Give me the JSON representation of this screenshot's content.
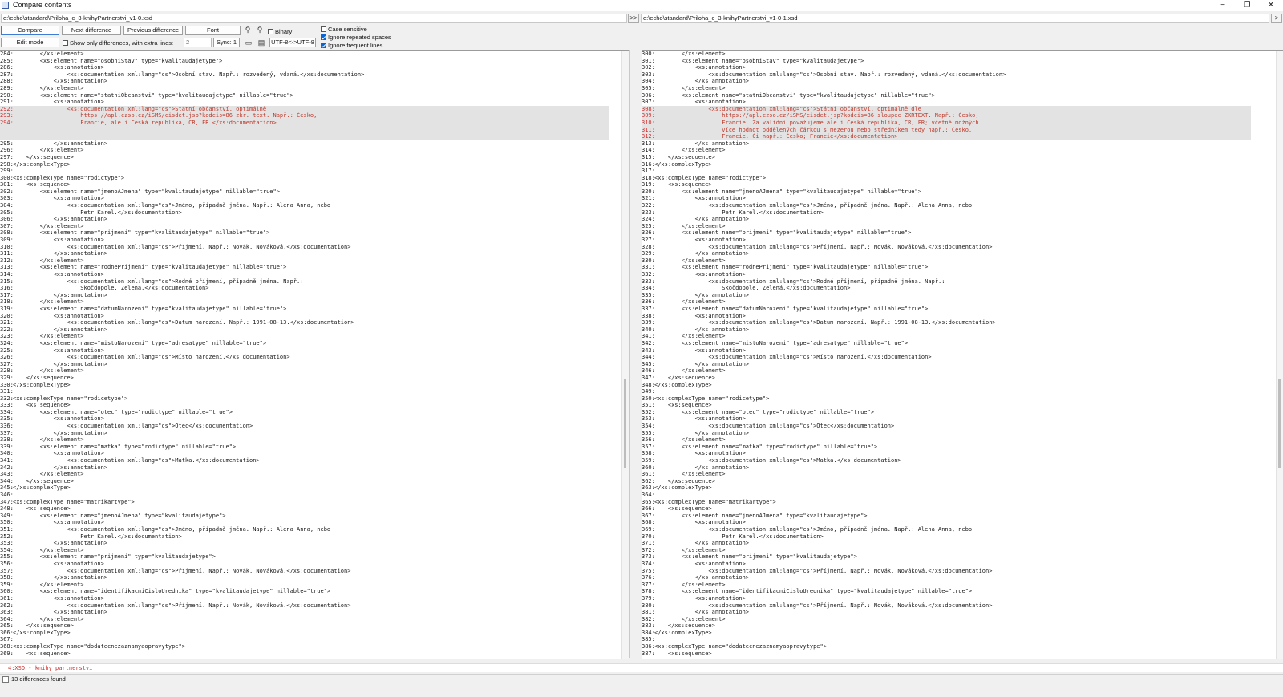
{
  "window": {
    "title": "Compare contents",
    "minimize": "−",
    "maximize": "❐",
    "close": "✕"
  },
  "paths": {
    "left": "e:\\echo\\standard\\Priloha_c_3-knihyPartnerstvi_v1-0.xsd",
    "right": "e:\\echo\\standard\\Priloha_c_3-knihyPartnerstvi_v1-0-1.xsd",
    "left_btn": ">>",
    "right_btn": ">"
  },
  "toolbar": {
    "compare": "Compare",
    "next": "Next difference",
    "prev": "Previous difference",
    "font": "Font",
    "binary": "Binary",
    "case_sensitive": "Case sensitive",
    "ignore_spaces": "Ignore repeated spaces",
    "ignore_frequent": "Ignore frequent lines",
    "edit_mode": "Edit mode",
    "show_only": "Show only differences, with extra lines:",
    "extra_lines": "2",
    "sync": "Sync: 1",
    "encoding": "UTF-8<->UTF-8"
  },
  "left": {
    "lines": [
      [
        "284:",
        "        </xs:element>"
      ],
      [
        "285:",
        "        <xs:element name=\"osobniStav\" type=\"kvalitaudajetype\">"
      ],
      [
        "286:",
        "            <xs:annotation>"
      ],
      [
        "287:",
        "                <xs:documentation xml:lang=\"cs\">Osobní stav. Např.: rozvedený, vdaná.</xs:documentation>"
      ],
      [
        "288:",
        "            </xs:annotation>"
      ],
      [
        "289:",
        "        </xs:element>"
      ],
      [
        "290:",
        "        <xs:element name=\"statniObcanstvi\" type=\"kvalitaudajetype\" nillable=\"true\">"
      ],
      [
        "291:",
        "            <xs:annotation>"
      ],
      [
        "292:",
        "                <xs:documentation xml:lang=\"cs\">Státní občanství, optimálně",
        "diff"
      ],
      [
        "293:",
        "                    https://apl.czso.cz/iSMS/cisdet.jsp?kodcis=86 zkr. text. Např.: Česko,",
        "diff"
      ],
      [
        "294:",
        "                    Francie, ale i Česká republika, ČR, FR.</xs:documentation>",
        "diff"
      ],
      [
        "",
        "",
        "pad"
      ],
      [
        "",
        "",
        "pad"
      ],
      [
        "295:",
        "            </xs:annotation>"
      ],
      [
        "296:",
        "        </xs:element>"
      ],
      [
        "297:",
        "    </xs:sequence>"
      ],
      [
        "298:",
        "</xs:complexType>"
      ],
      [
        "299:",
        ""
      ],
      [
        "300:",
        "<xs:complexType name=\"rodictype\">"
      ],
      [
        "301:",
        "    <xs:sequence>"
      ],
      [
        "302:",
        "        <xs:element name=\"jmenoAJmena\" type=\"kvalitaudajetype\" nillable=\"true\">"
      ],
      [
        "303:",
        "            <xs:annotation>"
      ],
      [
        "304:",
        "                <xs:documentation xml:lang=\"cs\">Jméno, případně jména. Např.: Alena Anna, nebo"
      ],
      [
        "305:",
        "                    Petr Karel.</xs:documentation>"
      ],
      [
        "306:",
        "            </xs:annotation>"
      ],
      [
        "307:",
        "        </xs:element>"
      ],
      [
        "308:",
        "        <xs:element name=\"prijmeni\" type=\"kvalitaudajetype\" nillable=\"true\">"
      ],
      [
        "309:",
        "            <xs:annotation>"
      ],
      [
        "310:",
        "                <xs:documentation xml:lang=\"cs\">Příjmení. Např.: Novák, Nováková.</xs:documentation>"
      ],
      [
        "311:",
        "            </xs:annotation>"
      ],
      [
        "312:",
        "        </xs:element>"
      ],
      [
        "313:",
        "        <xs:element name=\"rodnePrijmeni\" type=\"kvalitaudajetype\" nillable=\"true\">"
      ],
      [
        "314:",
        "            <xs:annotation>"
      ],
      [
        "315:",
        "                <xs:documentation xml:lang=\"cs\">Rodné příjmení, případně jména. Např.:"
      ],
      [
        "316:",
        "                    Skočdopole, Zelená.</xs:documentation>"
      ],
      [
        "317:",
        "            </xs:annotation>"
      ],
      [
        "318:",
        "        </xs:element>"
      ],
      [
        "319:",
        "        <xs:element name=\"datumNarozeni\" type=\"kvalitaudajetype\" nillable=\"true\">"
      ],
      [
        "320:",
        "            <xs:annotation>"
      ],
      [
        "321:",
        "                <xs:documentation xml:lang=\"cs\">Datum narození. Např.: 1991-08-13.</xs:documentation>"
      ],
      [
        "322:",
        "            </xs:annotation>"
      ],
      [
        "323:",
        "        </xs:element>"
      ],
      [
        "324:",
        "        <xs:element name=\"mistoNarozeni\" type=\"adresatype\" nillable=\"true\">"
      ],
      [
        "325:",
        "            <xs:annotation>"
      ],
      [
        "326:",
        "                <xs:documentation xml:lang=\"cs\">Místo narození.</xs:documentation>"
      ],
      [
        "327:",
        "            </xs:annotation>"
      ],
      [
        "328:",
        "        </xs:element>"
      ],
      [
        "329:",
        "    </xs:sequence>"
      ],
      [
        "330:",
        "</xs:complexType>"
      ],
      [
        "331:",
        ""
      ],
      [
        "332:",
        "<xs:complexType name=\"rodicetype\">"
      ],
      [
        "333:",
        "    <xs:sequence>"
      ],
      [
        "334:",
        "        <xs:element name=\"otec\" type=\"rodictype\" nillable=\"true\">"
      ],
      [
        "335:",
        "            <xs:annotation>"
      ],
      [
        "336:",
        "                <xs:documentation xml:lang=\"cs\">Otec</xs:documentation>"
      ],
      [
        "337:",
        "            </xs:annotation>"
      ],
      [
        "338:",
        "        </xs:element>"
      ],
      [
        "339:",
        "        <xs:element name=\"matka\" type=\"rodictype\" nillable=\"true\">"
      ],
      [
        "340:",
        "            <xs:annotation>"
      ],
      [
        "341:",
        "                <xs:documentation xml:lang=\"cs\">Matka.</xs:documentation>"
      ],
      [
        "342:",
        "            </xs:annotation>"
      ],
      [
        "343:",
        "        </xs:element>"
      ],
      [
        "344:",
        "    </xs:sequence>"
      ],
      [
        "345:",
        "</xs:complexType>"
      ],
      [
        "346:",
        ""
      ],
      [
        "347:",
        "<xs:complexType name=\"matrikartype\">"
      ],
      [
        "348:",
        "    <xs:sequence>"
      ],
      [
        "349:",
        "        <xs:element name=\"jmenoAJmena\" type=\"kvalitaudajetype\">"
      ],
      [
        "350:",
        "            <xs:annotation>"
      ],
      [
        "351:",
        "                <xs:documentation xml:lang=\"cs\">Jméno, případně jména. Např.: Alena Anna, nebo"
      ],
      [
        "352:",
        "                    Petr Karel.</xs:documentation>"
      ],
      [
        "353:",
        "            </xs:annotation>"
      ],
      [
        "354:",
        "        </xs:element>"
      ],
      [
        "355:",
        "        <xs:element name=\"prijmeni\" type=\"kvalitaudajetype\">"
      ],
      [
        "356:",
        "            <xs:annotation>"
      ],
      [
        "357:",
        "                <xs:documentation xml:lang=\"cs\">Příjmení. Např.: Novák, Nováková.</xs:documentation>"
      ],
      [
        "358:",
        "            </xs:annotation>"
      ],
      [
        "359:",
        "        </xs:element>"
      ],
      [
        "360:",
        "        <xs:element name=\"identifikacniCisloUrednika\" type=\"kvalitaudajetype\" nillable=\"true\">"
      ],
      [
        "361:",
        "            <xs:annotation>"
      ],
      [
        "362:",
        "                <xs:documentation xml:lang=\"cs\">Příjmení. Např.: Novák, Nováková.</xs:documentation>"
      ],
      [
        "363:",
        "            </xs:annotation>"
      ],
      [
        "364:",
        "        </xs:element>"
      ],
      [
        "365:",
        "    </xs:sequence>"
      ],
      [
        "366:",
        "</xs:complexType>"
      ],
      [
        "367:",
        ""
      ],
      [
        "368:",
        "<xs:complexType name=\"dodatecnezaznamyaopravytype\">"
      ],
      [
        "369:",
        "    <xs:sequence>"
      ]
    ]
  },
  "right": {
    "lines": [
      [
        "300:",
        "        </xs:element>"
      ],
      [
        "301:",
        "        <xs:element name=\"osobniStav\" type=\"kvalitaudajetype\">"
      ],
      [
        "302:",
        "            <xs:annotation>"
      ],
      [
        "303:",
        "                <xs:documentation xml:lang=\"cs\">Osobní stav. Např.: rozvedený, vdaná.</xs:documentation>"
      ],
      [
        "304:",
        "            </xs:annotation>"
      ],
      [
        "305:",
        "        </xs:element>"
      ],
      [
        "306:",
        "        <xs:element name=\"statniObcanstvi\" type=\"kvalitaudajetype\" nillable=\"true\">"
      ],
      [
        "307:",
        "            <xs:annotation>"
      ],
      [
        "308:",
        "                <xs:documentation xml:lang=\"cs\">Státní občanství, optimálně dle",
        "diff"
      ],
      [
        "309:",
        "                    https://apl.czso.cz/iSMS/cisdet.jsp?kodcis=86 sloupec ZKRTEXT. Např.: Česko,",
        "diff"
      ],
      [
        "310:",
        "                    Francie. Za validní považujeme ale i Česká republika, ČR, FR; včetně možných",
        "diff"
      ],
      [
        "311:",
        "                    více hodnot oddělených čárkou s mezerou nebo středníkem tedy např.: Česko,",
        "diff"
      ],
      [
        "312:",
        "                    Francie. Či např.: Česko; Francie</xs:documentation>",
        "diff"
      ],
      [
        "313:",
        "            </xs:annotation>"
      ],
      [
        "314:",
        "        </xs:element>"
      ],
      [
        "315:",
        "    </xs:sequence>"
      ],
      [
        "316:",
        "</xs:complexType>"
      ],
      [
        "317:",
        ""
      ],
      [
        "318:",
        "<xs:complexType name=\"rodictype\">"
      ],
      [
        "319:",
        "    <xs:sequence>"
      ],
      [
        "320:",
        "        <xs:element name=\"jmenoAJmena\" type=\"kvalitaudajetype\" nillable=\"true\">"
      ],
      [
        "321:",
        "            <xs:annotation>"
      ],
      [
        "322:",
        "                <xs:documentation xml:lang=\"cs\">Jméno, případně jména. Např.: Alena Anna, nebo"
      ],
      [
        "323:",
        "                    Petr Karel.</xs:documentation>"
      ],
      [
        "324:",
        "            </xs:annotation>"
      ],
      [
        "325:",
        "        </xs:element>"
      ],
      [
        "326:",
        "        <xs:element name=\"prijmeni\" type=\"kvalitaudajetype\" nillable=\"true\">"
      ],
      [
        "327:",
        "            <xs:annotation>"
      ],
      [
        "328:",
        "                <xs:documentation xml:lang=\"cs\">Příjmení. Např.: Novák, Nováková.</xs:documentation>"
      ],
      [
        "329:",
        "            </xs:annotation>"
      ],
      [
        "330:",
        "        </xs:element>"
      ],
      [
        "331:",
        "        <xs:element name=\"rodnePrijmeni\" type=\"kvalitaudajetype\" nillable=\"true\">"
      ],
      [
        "332:",
        "            <xs:annotation>"
      ],
      [
        "333:",
        "                <xs:documentation xml:lang=\"cs\">Rodné příjmení, případně jména. Např.:"
      ],
      [
        "334:",
        "                    Skočdopole, Zelená.</xs:documentation>"
      ],
      [
        "335:",
        "            </xs:annotation>"
      ],
      [
        "336:",
        "        </xs:element>"
      ],
      [
        "337:",
        "        <xs:element name=\"datumNarozeni\" type=\"kvalitaudajetype\" nillable=\"true\">"
      ],
      [
        "338:",
        "            <xs:annotation>"
      ],
      [
        "339:",
        "                <xs:documentation xml:lang=\"cs\">Datum narození. Např.: 1991-08-13.</xs:documentation>"
      ],
      [
        "340:",
        "            </xs:annotation>"
      ],
      [
        "341:",
        "        </xs:element>"
      ],
      [
        "342:",
        "        <xs:element name=\"mistoNarozeni\" type=\"adresatype\" nillable=\"true\">"
      ],
      [
        "343:",
        "            <xs:annotation>"
      ],
      [
        "344:",
        "                <xs:documentation xml:lang=\"cs\">Místo narození.</xs:documentation>"
      ],
      [
        "345:",
        "            </xs:annotation>"
      ],
      [
        "346:",
        "        </xs:element>"
      ],
      [
        "347:",
        "    </xs:sequence>"
      ],
      [
        "348:",
        "</xs:complexType>"
      ],
      [
        "349:",
        ""
      ],
      [
        "350:",
        "<xs:complexType name=\"rodicetype\">"
      ],
      [
        "351:",
        "    <xs:sequence>"
      ],
      [
        "352:",
        "        <xs:element name=\"otec\" type=\"rodictype\" nillable=\"true\">"
      ],
      [
        "353:",
        "            <xs:annotation>"
      ],
      [
        "354:",
        "                <xs:documentation xml:lang=\"cs\">Otec</xs:documentation>"
      ],
      [
        "355:",
        "            </xs:annotation>"
      ],
      [
        "356:",
        "        </xs:element>"
      ],
      [
        "357:",
        "        <xs:element name=\"matka\" type=\"rodictype\" nillable=\"true\">"
      ],
      [
        "358:",
        "            <xs:annotation>"
      ],
      [
        "359:",
        "                <xs:documentation xml:lang=\"cs\">Matka.</xs:documentation>"
      ],
      [
        "360:",
        "            </xs:annotation>"
      ],
      [
        "361:",
        "        </xs:element>"
      ],
      [
        "362:",
        "    </xs:sequence>"
      ],
      [
        "363:",
        "</xs:complexType>"
      ],
      [
        "364:",
        ""
      ],
      [
        "365:",
        "<xs:complexType name=\"matrikartype\">"
      ],
      [
        "366:",
        "    <xs:sequence>"
      ],
      [
        "367:",
        "        <xs:element name=\"jmenoAJmena\" type=\"kvalitaudajetype\">"
      ],
      [
        "368:",
        "            <xs:annotation>"
      ],
      [
        "369:",
        "                <xs:documentation xml:lang=\"cs\">Jméno, případně jména. Např.: Alena Anna, nebo"
      ],
      [
        "370:",
        "                    Petr Karel.</xs:documentation>"
      ],
      [
        "371:",
        "            </xs:annotation>"
      ],
      [
        "372:",
        "        </xs:element>"
      ],
      [
        "373:",
        "        <xs:element name=\"prijmeni\" type=\"kvalitaudajetype\">"
      ],
      [
        "374:",
        "            <xs:annotation>"
      ],
      [
        "375:",
        "                <xs:documentation xml:lang=\"cs\">Příjmení. Např.: Novák, Nováková.</xs:documentation>"
      ],
      [
        "376:",
        "            </xs:annotation>"
      ],
      [
        "377:",
        "        </xs:element>"
      ],
      [
        "378:",
        "        <xs:element name=\"identifikacniCisloUrednika\" type=\"kvalitaudajetype\" nillable=\"true\">"
      ],
      [
        "379:",
        "            <xs:annotation>"
      ],
      [
        "380:",
        "                <xs:documentation xml:lang=\"cs\">Příjmení. Např.: Novák, Nováková.</xs:documentation>"
      ],
      [
        "381:",
        "            </xs:annotation>"
      ],
      [
        "382:",
        "        </xs:element>"
      ],
      [
        "383:",
        "    </xs:sequence>"
      ],
      [
        "384:",
        "</xs:complexType>"
      ],
      [
        "385:",
        ""
      ],
      [
        "386:",
        "<xs:complexType name=\"dodatecnezaznamyaopravytype\">"
      ],
      [
        "387:",
        "    <xs:sequence>"
      ]
    ]
  },
  "section_label": "4:XSD - knihy partnerstvi",
  "status": "13 differences found"
}
